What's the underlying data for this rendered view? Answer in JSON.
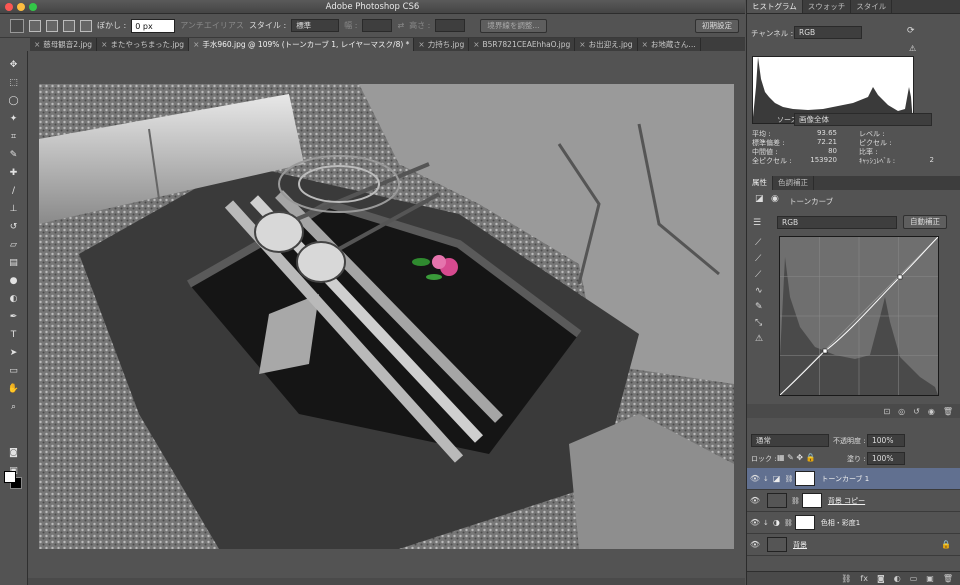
{
  "window": {
    "title": "Adobe Photoshop CS6"
  },
  "options_bar": {
    "feather_label": "ぼかし :",
    "feather_value": "0 px",
    "antialias_label": "アンチエイリアス",
    "style_label": "スタイル :",
    "style_value": "標準",
    "width_label": "幅 :",
    "height_label": "高さ :",
    "refine_edge_button": "境界線を調整...",
    "workspace_button": "初期設定"
  },
  "doc_tabs": [
    {
      "label": "慈母観音2.jpg",
      "active": false
    },
    {
      "label": "またやっちまった.jpg",
      "active": false
    },
    {
      "label": "手水960.jpg @ 109% (トーンカーブ 1, レイヤーマスク/8) *",
      "active": true
    },
    {
      "label": "力持ち.jpg",
      "active": false
    },
    {
      "label": "B5R7821CEAEhhaO.jpg",
      "active": false
    },
    {
      "label": "お出迎え.jpg",
      "active": false
    },
    {
      "label": "お地蔵さん…",
      "active": false
    }
  ],
  "histogram_panel": {
    "tabs": [
      "ヒストグラム",
      "スウォッチ",
      "スタイル"
    ],
    "channel_label": "チャンネル :",
    "channel_value": "RGB",
    "source_label": "ソース :",
    "source_value": "画像全体",
    "stats": [
      {
        "label": "平均 :",
        "value": "93.65"
      },
      {
        "label": "標準偏差 :",
        "value": "72.21"
      },
      {
        "label": "中間値 :",
        "value": "80"
      },
      {
        "label": "全ピクセル :",
        "value": "153920"
      }
    ],
    "stats_right": [
      {
        "label": "レベル :",
        "value": ""
      },
      {
        "label": "ピクセル :",
        "value": ""
      },
      {
        "label": "比率 :",
        "value": ""
      },
      {
        "label": "ｷｬｯｼｭﾚﾍﾞﾙ :",
        "value": "2"
      }
    ]
  },
  "properties_panel": {
    "tabs": [
      "属性",
      "色調補正"
    ],
    "adjustment_name": "トーンカーブ",
    "preset_value": "RGB",
    "auto_button": "自動補正"
  },
  "layers_panel": {
    "blend_mode": "通常",
    "opacity_label": "不透明度 :",
    "opacity_value": "100%",
    "lock_label": "ロック :",
    "fill_label": "塗り :",
    "fill_value": "100%",
    "layers": [
      {
        "name": "トーンカーブ 1",
        "selected": true
      },
      {
        "name": "背景 コピー",
        "selected": false
      },
      {
        "name": "色相・彩度1",
        "selected": false
      },
      {
        "name": "背景",
        "selected": false
      }
    ]
  },
  "colors": {
    "selected_layer": "#617090",
    "panel_bg": "#535353"
  }
}
